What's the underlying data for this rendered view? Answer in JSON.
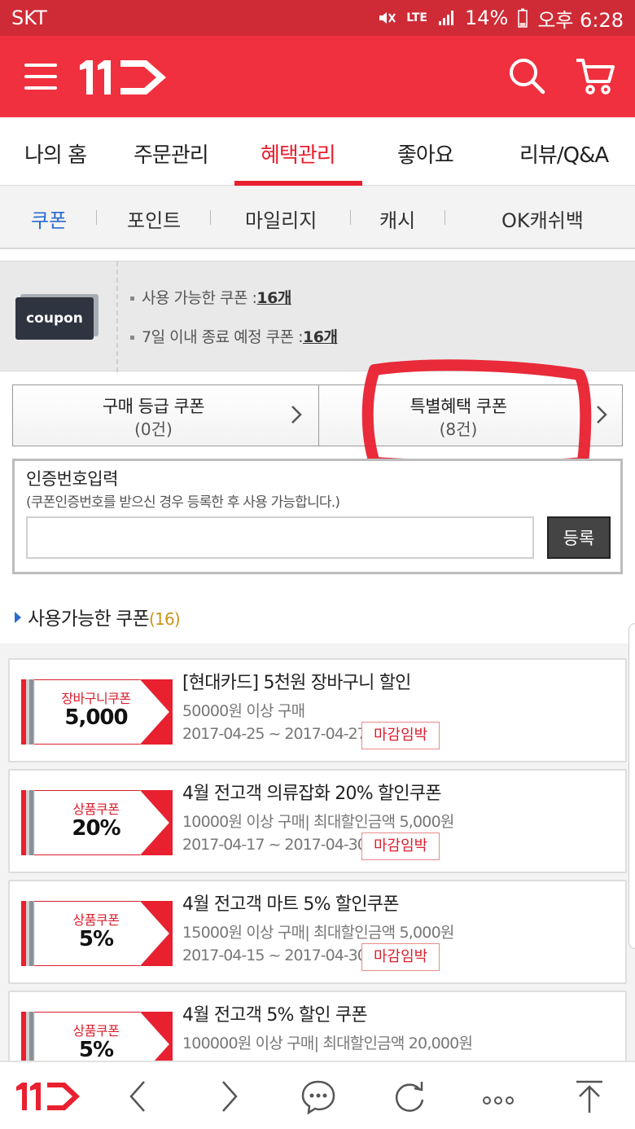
{
  "status_bar": {
    "carrier": "SKT",
    "network": "LTE",
    "battery": "14%",
    "time": "오후 6:28"
  },
  "header": {
    "logo": "11",
    "menu_icon": "hamburger-icon",
    "search_icon": "search-icon",
    "cart_icon": "cart-icon",
    "brand_color": "#f1303f"
  },
  "main_tabs": [
    {
      "label": "나의 홈"
    },
    {
      "label": "주문관리"
    },
    {
      "label": "혜택관리",
      "active": true
    },
    {
      "label": "좋아요"
    },
    {
      "label": "리뷰/Q&A"
    }
  ],
  "sub_tabs": [
    {
      "label": "쿠폰",
      "active": true
    },
    {
      "label": "포인트"
    },
    {
      "label": "마일리지"
    },
    {
      "label": "캐시"
    },
    {
      "label": "OK캐쉬백"
    }
  ],
  "summary": {
    "badge": "coupon",
    "available_label": "사용 가능한 쿠폰 :",
    "available_count": "16개",
    "expiring_label": "7일 이내 종료 예정 쿠폰 :",
    "expiring_count": "16개"
  },
  "grade_buttons": [
    {
      "label": "구매 등급 쿠폰",
      "count": "(0건)"
    },
    {
      "label": "특별혜택 쿠폰",
      "count": "(8건)"
    }
  ],
  "auth": {
    "title": "인증번호입력",
    "description": "(쿠폰인증번호를 받으신 경우 등록한 후 사용 가능합니다.)",
    "input_value": "",
    "button": "등록"
  },
  "available": {
    "title": "사용가능한 쿠폰",
    "count": "(16)"
  },
  "coupons": [
    {
      "type": "장바구니쿠폰",
      "value": "5,000",
      "title": "[현대카드] 5천원 장바구니 할인",
      "condition": "50000원 이상 구매",
      "period": "2017-04-25 ~ 2017-04-27",
      "badge": "마감임박"
    },
    {
      "type": "상품쿠폰",
      "value": "20%",
      "title": "4월 전고객 의류잡화 20% 할인쿠폰",
      "condition": "10000원 이상 구매| 최대할인금액 5,000원",
      "period": "2017-04-17 ~ 2017-04-30",
      "badge": "마감임박"
    },
    {
      "type": "상품쿠폰",
      "value": "5%",
      "title": "4월 전고객 마트 5% 할인쿠폰",
      "condition": "15000원 이상 구매| 최대할인금액 5,000원",
      "period": "2017-04-15 ~ 2017-04-30",
      "badge": "마감임박"
    },
    {
      "type": "상품쿠폰",
      "value": "5%",
      "title": "4월 전고객 5% 할인 쿠폰",
      "condition": "100000원 이상 구매| 최대할인금액 20,000원",
      "period": "",
      "badge": ""
    }
  ],
  "bottom_bar": {
    "logo": "11",
    "icons": [
      "back-icon",
      "forward-icon",
      "chat-icon",
      "refresh-icon",
      "more-icon",
      "top-icon"
    ]
  }
}
